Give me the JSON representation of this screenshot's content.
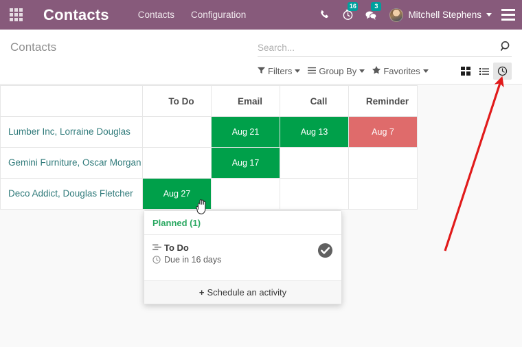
{
  "topbar": {
    "apps_icon": "apps-grid-icon",
    "brand": "Contacts",
    "menus": [
      {
        "label": "Contacts"
      },
      {
        "label": "Configuration"
      }
    ],
    "phone_icon": "phone-icon",
    "activity_icon": "clock-icon",
    "activity_badge": "16",
    "messages_icon": "chat-icon",
    "messages_badge": "3",
    "username": "Mitchell Stephens",
    "avatar": "user-avatar",
    "menu_icon": "hamburger-icon"
  },
  "control_panel": {
    "title": "Contacts",
    "search": {
      "value": "",
      "placeholder": "Search..."
    },
    "search_icon": "search-icon",
    "tools": [
      {
        "label": "Filters",
        "icon": "filter-icon"
      },
      {
        "label": "Group By",
        "icon": "list-lines-icon"
      },
      {
        "label": "Favorites",
        "icon": "star-icon"
      }
    ],
    "views": [
      {
        "name": "kanban",
        "icon": "kanban-icon",
        "active": false
      },
      {
        "name": "list",
        "icon": "list-icon",
        "active": false
      },
      {
        "name": "activity",
        "icon": "activity-clock-icon",
        "active": true
      }
    ]
  },
  "activity_table": {
    "columns": [
      "",
      "To Do",
      "Email",
      "Call",
      "Reminder"
    ],
    "rows": [
      {
        "name": "Lumber Inc, Lorraine Douglas",
        "cells": [
          {
            "label": "",
            "state": "empty"
          },
          {
            "label": "Aug 21",
            "state": "planned"
          },
          {
            "label": "Aug 13",
            "state": "planned"
          },
          {
            "label": "Aug 7",
            "state": "overdue"
          }
        ]
      },
      {
        "name": "Gemini Furniture, Oscar Morgan",
        "cells": [
          {
            "label": "",
            "state": "empty"
          },
          {
            "label": "Aug 17",
            "state": "planned"
          },
          {
            "label": "",
            "state": "empty"
          },
          {
            "label": "",
            "state": "empty"
          }
        ]
      },
      {
        "name": "Deco Addict, Douglas Fletcher",
        "cells": [
          {
            "label": "Aug 27",
            "state": "planned"
          },
          {
            "label": "",
            "state": "empty"
          },
          {
            "label": "",
            "state": "empty"
          },
          {
            "label": "",
            "state": "empty"
          }
        ]
      }
    ]
  },
  "popover": {
    "title": "Planned (1)",
    "activity": {
      "type": "To Do",
      "type_icon": "activity-type-icon",
      "due": "Due in 16 days",
      "due_icon": "clock-icon",
      "done_icon": "check-circle-icon"
    },
    "footer_label": "Schedule an activity",
    "footer_plus": "+"
  },
  "colors": {
    "brand_purple": "#875A7B",
    "planned_green": "#00A04A",
    "overdue_red": "#DF6B6B",
    "badge_teal": "#00A09D",
    "link_teal": "#2F7A7A",
    "annotation_red": "#E11B1B"
  }
}
